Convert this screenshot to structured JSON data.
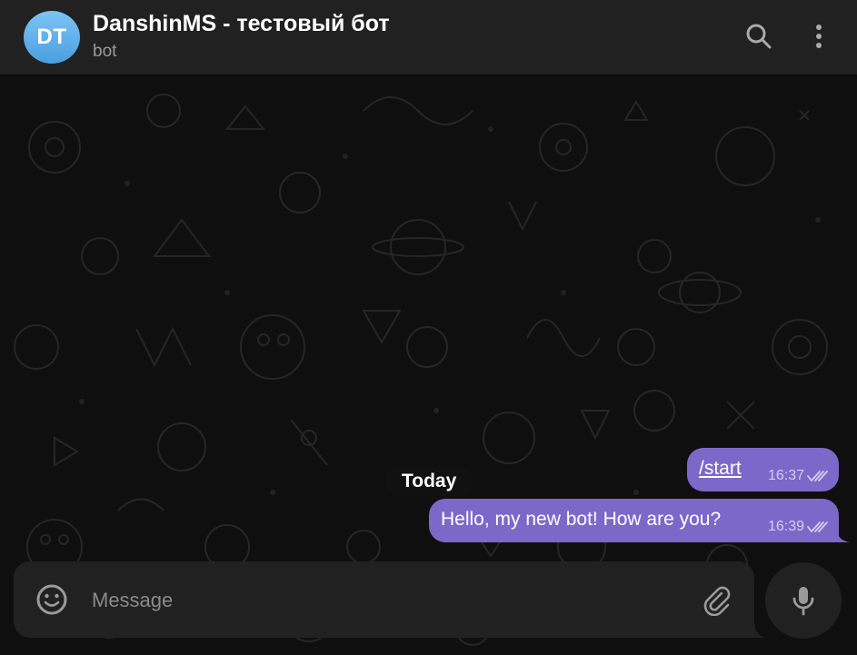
{
  "header": {
    "avatar_initials": "DT",
    "title": "DanshinMS - тестовый бот",
    "subtitle": "bot",
    "search_icon": "search-icon",
    "menu_icon": "more-vertical-icon"
  },
  "chat": {
    "date_separator": "Today",
    "messages": [
      {
        "text": "/start",
        "time": "16:37",
        "status": "read",
        "is_command": true
      },
      {
        "text": "Hello, my new bot! How are you?",
        "time": "16:39",
        "status": "read",
        "is_command": false
      }
    ]
  },
  "composer": {
    "placeholder": "Message",
    "value": "",
    "emoji_icon": "smile-icon",
    "attach_icon": "paperclip-icon",
    "mic_icon": "microphone-icon"
  },
  "colors": {
    "header_bg": "#212121",
    "chat_bg": "#0f0f0f",
    "outgoing_bubble": "#7b69c9",
    "avatar_gradient_top": "#7cc4f5",
    "avatar_gradient_bottom": "#4b9fe0"
  }
}
